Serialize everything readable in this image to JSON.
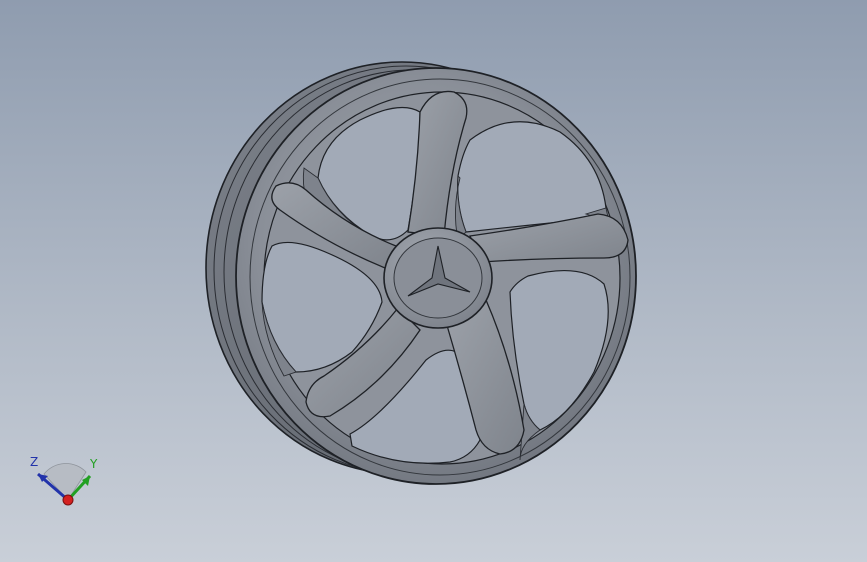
{
  "viewport": {
    "background_top": "#8f9caf",
    "background_bottom": "#c9cfd8"
  },
  "model": {
    "name": "wheel-rim",
    "spoke_count": 5,
    "body_color": "#8c919a",
    "edge_color": "#1e2126"
  },
  "triad": {
    "z_label": "Z",
    "y_label": "Y",
    "x_color": "#d42020",
    "y_color": "#22a022",
    "z_color": "#2233aa"
  }
}
